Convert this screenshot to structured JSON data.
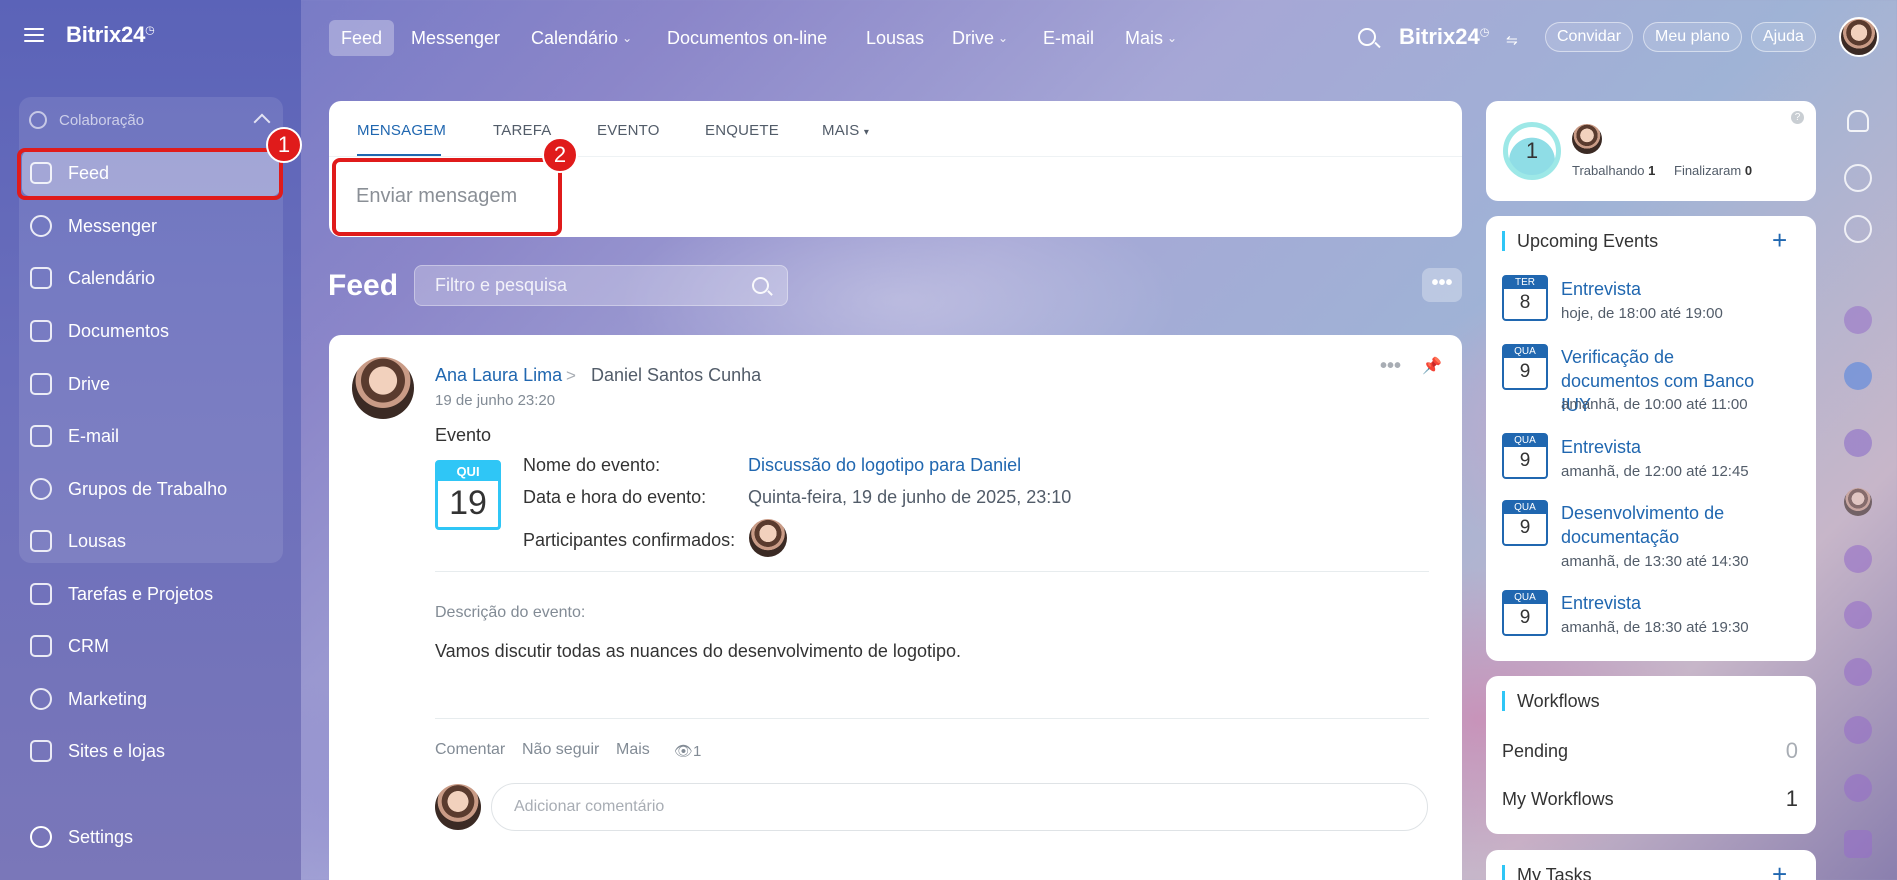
{
  "sidebar": {
    "brand": "Bitrix24",
    "brand_mark": "◷",
    "section": "Colaboração",
    "items": [
      {
        "label": "Feed"
      },
      {
        "label": "Messenger"
      },
      {
        "label": "Calendário"
      },
      {
        "label": "Documentos"
      },
      {
        "label": "Drive"
      },
      {
        "label": "E-mail"
      },
      {
        "label": "Grupos de Trabalho"
      },
      {
        "label": "Lousas"
      },
      {
        "label": "Tarefas e Projetos"
      },
      {
        "label": "CRM"
      },
      {
        "label": "Marketing"
      },
      {
        "label": "Sites e lojas"
      }
    ],
    "settings": "Settings"
  },
  "annotations": {
    "one": "1",
    "two": "2"
  },
  "topbar": {
    "nav": [
      {
        "label": "Feed"
      },
      {
        "label": "Messenger"
      },
      {
        "label": "Calendário",
        "chevron": "⌄"
      },
      {
        "label": "Documentos on-line"
      },
      {
        "label": "Lousas"
      },
      {
        "label": "Drive",
        "chevron": "⌄"
      },
      {
        "label": "E-mail"
      },
      {
        "label": "Mais",
        "chevron": "⌄"
      }
    ],
    "brand": "Bitrix24",
    "brand_mark": "◷",
    "invite": "Convidar",
    "plan": "Meu plano",
    "help": "Ajuda"
  },
  "composer": {
    "tabs": [
      "MENSAGEM",
      "TAREFA",
      "EVENTO",
      "ENQUETE",
      "MAIS"
    ],
    "more_caret": "▾",
    "placeholder": "Enviar mensagem"
  },
  "feed": {
    "title": "Feed",
    "filter_placeholder": "Filtro e pesquisa",
    "more": "•••"
  },
  "post": {
    "author": "Ana Laura Lima",
    "arrow": ">",
    "recipient": "Daniel Santos Cunha",
    "date": "19 de junho 23:20",
    "type": "Evento",
    "cal_weekday": "QUI",
    "cal_day": "19",
    "fields": [
      {
        "label": "Nome do evento:",
        "value": "Discussão do logotipo para Daniel"
      },
      {
        "label": "Data e hora do evento:",
        "value": "Quinta-feira, 19 de junho de 2025, 23:10"
      },
      {
        "label": "Participantes confirmados:"
      }
    ],
    "description_label": "Descrição do evento:",
    "description": "Vamos discutir todas as nuances do desenvolvimento de logotipo.",
    "actions": [
      "Comentar",
      "Não seguir",
      "Mais"
    ],
    "views": "1",
    "comment_placeholder": "Adicionar comentário",
    "dots": "•••",
    "pin_icon": "pin"
  },
  "timeman": {
    "count": "1",
    "working_label": "Trabalhando",
    "working_value": "1",
    "finished_label": "Finalizaram",
    "finished_value": "0",
    "help": "?"
  },
  "events": {
    "title": "Upcoming Events",
    "add": "+",
    "items": [
      {
        "weekday": "TER",
        "day": "8",
        "title": "Entrevista",
        "time": "hoje, de 18:00 até 19:00"
      },
      {
        "weekday": "QUA",
        "day": "9",
        "title": "Verificação de documentos com Banco IUY",
        "time": "amanhã, de 10:00 até 11:00"
      },
      {
        "weekday": "QUA",
        "day": "9",
        "title": "Entrevista",
        "time": "amanhã, de 12:00 até 12:45"
      },
      {
        "weekday": "QUA",
        "day": "9",
        "title": "Desenvolvimento de documentação",
        "time": "amanhã, de 13:30 até 14:30"
      },
      {
        "weekday": "QUA",
        "day": "9",
        "title": "Entrevista",
        "time": "amanhã, de 18:30 até 19:30"
      }
    ]
  },
  "workflows": {
    "title": "Workflows",
    "pending_label": "Pending",
    "pending_value": "0",
    "my_label": "My Workflows",
    "my_value": "1"
  },
  "tasks": {
    "title": "My Tasks",
    "add": "+"
  },
  "colors": {
    "accent": "#2067b0",
    "highlight": "#e01b1b",
    "calendar": "#2fc6f6"
  }
}
